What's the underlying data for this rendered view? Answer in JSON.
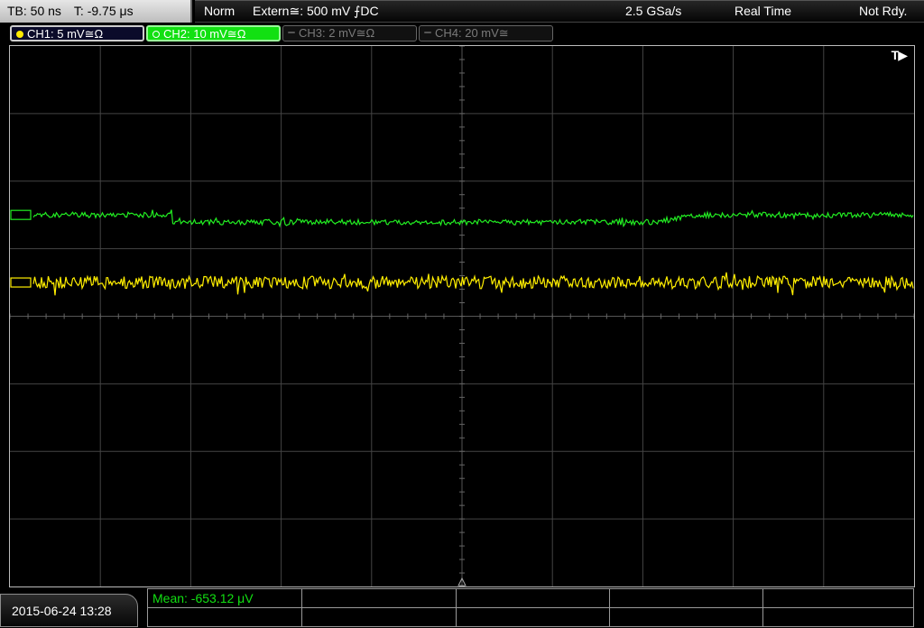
{
  "topbar": {
    "timebase": "TB: 50 ns",
    "trigger_time": "T: -9.75 μs",
    "trigger_mode": "Norm",
    "trigger_source": "Extern≅: 500 mV ⨍DC",
    "sample_rate": "2.5 GSa/s",
    "acquisition_mode": "Real Time",
    "status": "Not Rdy."
  },
  "channels": [
    {
      "label": "CH1: 5 mV≅Ω",
      "state": "active",
      "color": "#ffea00"
    },
    {
      "label": "CH2: 10 mV≅Ω",
      "state": "selected",
      "color": "#12e012"
    },
    {
      "label": "CH3: 2 mV≅Ω",
      "state": "off",
      "color": "#7a7a7a"
    },
    {
      "label": "CH4: 20 mV≅",
      "state": "off",
      "color": "#7a7a7a"
    }
  ],
  "display": {
    "trigger_marker": "T▶",
    "h_divisions": 10,
    "v_divisions": 8,
    "grid_color": "#444444",
    "ch2_trace_color": "#22ee22",
    "ch1_trace_color": "#ffee00",
    "ch2_offset_div": 5.5,
    "ch1_offset_div": 4.5
  },
  "footer": {
    "timestamp": "2015-06-24 13:28",
    "measurement": "Mean: -653.12 μV"
  }
}
